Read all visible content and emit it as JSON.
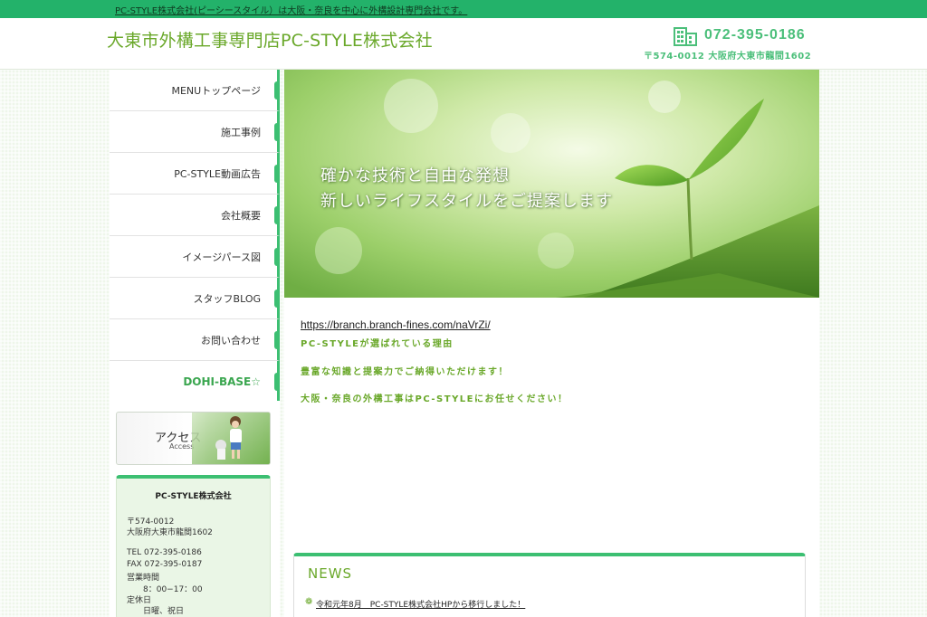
{
  "topbar": {
    "text": "PC-STYLE株式会社(ピーシースタイル）は大阪・奈良を中心に外構設計専門会社です。"
  },
  "header": {
    "title": "大東市外構工事専門店PC-STYLE株式会社",
    "phone": "072-395-0186",
    "address": "〒574-0012 大阪府大東市龍間1602",
    "icon": "building-icon"
  },
  "nav": {
    "items": [
      {
        "label": "MENUトップページ"
      },
      {
        "label": "施工事例"
      },
      {
        "label": "PC-STYLE動画広告"
      },
      {
        "label": "会社概要"
      },
      {
        "label": "イメージパース図"
      },
      {
        "label": "スタッフBLOG"
      },
      {
        "label": "お問い合わせ"
      },
      {
        "label": "DOHI-BASE☆"
      }
    ]
  },
  "access": {
    "title": "アクセス",
    "subtitle": "Access"
  },
  "company": {
    "name": "PC-STYLE株式会社",
    "zip": "〒574-0012",
    "address": "大阪府大東市龍間1602",
    "tel": "TEL 072-395-0186",
    "fax": "FAX 072-395-0187",
    "hours_label": "営業時間",
    "hours": "8：00−17：00",
    "closed_label": "定休日",
    "closed": "日曜、祝日"
  },
  "hero": {
    "line1": "確かな技術と自由な発想",
    "line2": "新しいライフスタイルをご提案します"
  },
  "main": {
    "link": "https://branch.branch-fines.com/naVrZi/",
    "intro1": "PC-STYLEが選ばれている理由",
    "intro2": "豊富な知識と提案力でご納得いただけます！",
    "intro3": "大阪・奈良の外構工事はPC-STYLEにお任せください！"
  },
  "news": {
    "title": "NEWS",
    "items": [
      {
        "text": "令和元年8月　PC-STYLE株式会社HPから移行しました！"
      }
    ]
  },
  "colors": {
    "accent": "#3cbf72",
    "topbar": "#23b26a",
    "title_green": "#6aa82a"
  }
}
